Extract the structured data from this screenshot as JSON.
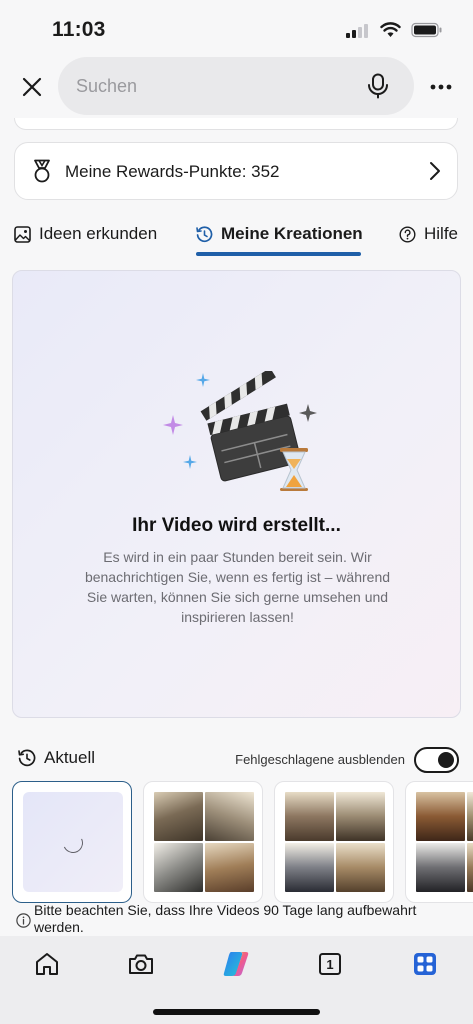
{
  "status_bar": {
    "time": "11:03"
  },
  "search": {
    "placeholder": "Suchen"
  },
  "rewards": {
    "label": "Meine Rewards-Punkte: 352"
  },
  "tabs": [
    {
      "label": "Ideen erkunden"
    },
    {
      "label": "Meine Kreationen"
    },
    {
      "label": "Hilfe"
    }
  ],
  "creation": {
    "title": "Ihr Video wird erstellt...",
    "description": "Es wird in ein paar Stunden bereit sein. Wir benachrichtigen Sie, wenn es fertig ist – während Sie warten, können Sie sich gerne umsehen und inspirieren lassen!"
  },
  "recent": {
    "label": "Aktuell",
    "hide_failed_label": "Fehlgeschlagene ausblenden",
    "hide_failed_on": true
  },
  "notice": {
    "text": "Bitte beachten Sie, dass Ihre Videos 90 Tage lang aufbewahrt werden."
  },
  "nav": {
    "tab_count": "1"
  },
  "colors": {
    "accent": "#1f5fa8",
    "nav_bg": "#ededef"
  }
}
